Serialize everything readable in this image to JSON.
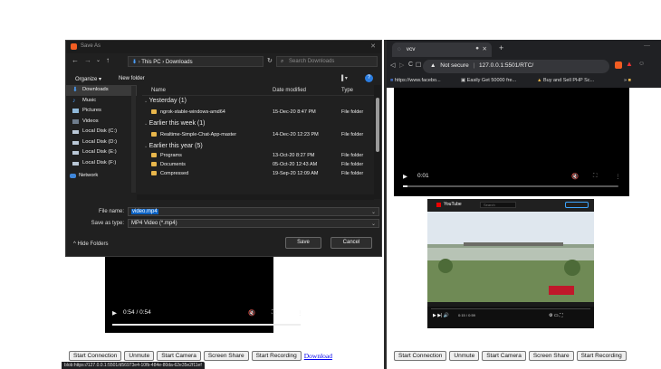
{
  "dialog": {
    "title": "Save As",
    "close": "✕",
    "path": "This PC  ›  Downloads",
    "search_placeholder": "Search Downloads",
    "organize": "Organize ▾",
    "new_folder": "New folder",
    "nav_items": [
      "Downloads",
      "Music",
      "Pictures",
      "Videos",
      "Local Disk (C:)",
      "Local Disk (D:)",
      "Local Disk (E:)",
      "Local Disk (F:)",
      "Network"
    ],
    "columns": {
      "name": "Name",
      "date": "Date modified",
      "type": "Type"
    },
    "groups": [
      {
        "label": "Yesterday (1)",
        "rows": [
          {
            "name": "ngrok-stable-windows-amd64",
            "date": "15-Dec-20 8:47 PM",
            "type": "File folder"
          }
        ]
      },
      {
        "label": "Earlier this week (1)",
        "rows": [
          {
            "name": "Realtime-Simple-Chat-App-master",
            "date": "14-Dec-20 12:23 PM",
            "type": "File folder"
          }
        ]
      },
      {
        "label": "Earlier this year (5)",
        "rows": [
          {
            "name": "Programs",
            "date": "13-Oct-20 8:27 PM",
            "type": "File folder"
          },
          {
            "name": "Documents",
            "date": "05-Oct-20 12:43 AM",
            "type": "File folder"
          },
          {
            "name": "Compressed",
            "date": "19-Sep-20 12:09 AM",
            "type": "File folder"
          }
        ]
      }
    ],
    "file_name_label": "File name:",
    "file_name": "video.mp4",
    "save_type_label": "Save as type:",
    "save_type": "MP4 Video (*.mp4)",
    "hide_folders": "Hide Folders",
    "save": "Save",
    "cancel": "Cancel"
  },
  "left_video": {
    "time": "0:54 / 0:54",
    "progress": 1.0
  },
  "left_buttons": [
    "Start Connection",
    "Unmute",
    "Start Camera",
    "Screen Share",
    "Start Recording"
  ],
  "download_link": "Download",
  "status_url": "blob:https://127.0.0.1:5501/d56973e4-10fb-484e-80da-62e35e2f11ef",
  "right_browser": {
    "tab_title": "vcv",
    "security": "Not secure",
    "url": "127.0.0.1:5501/RTC/",
    "bookmarks": [
      "https://www.facebo...",
      "Easily Get 50000 fre...",
      "Buy and Sell PHP Sc..."
    ],
    "video_time": "0:01",
    "video_progress": 0.02,
    "yt_logo": "YouTube",
    "yt_search": "Search",
    "yt_time": "0:15 / 0:59",
    "buttons": [
      "Start Connection",
      "Unmute",
      "Start Camera",
      "Screen Share",
      "Start Recording"
    ]
  },
  "colors": {
    "folder": "#e8b64b",
    "accent": "#0b62c4",
    "dialog_bg": "#202020"
  }
}
